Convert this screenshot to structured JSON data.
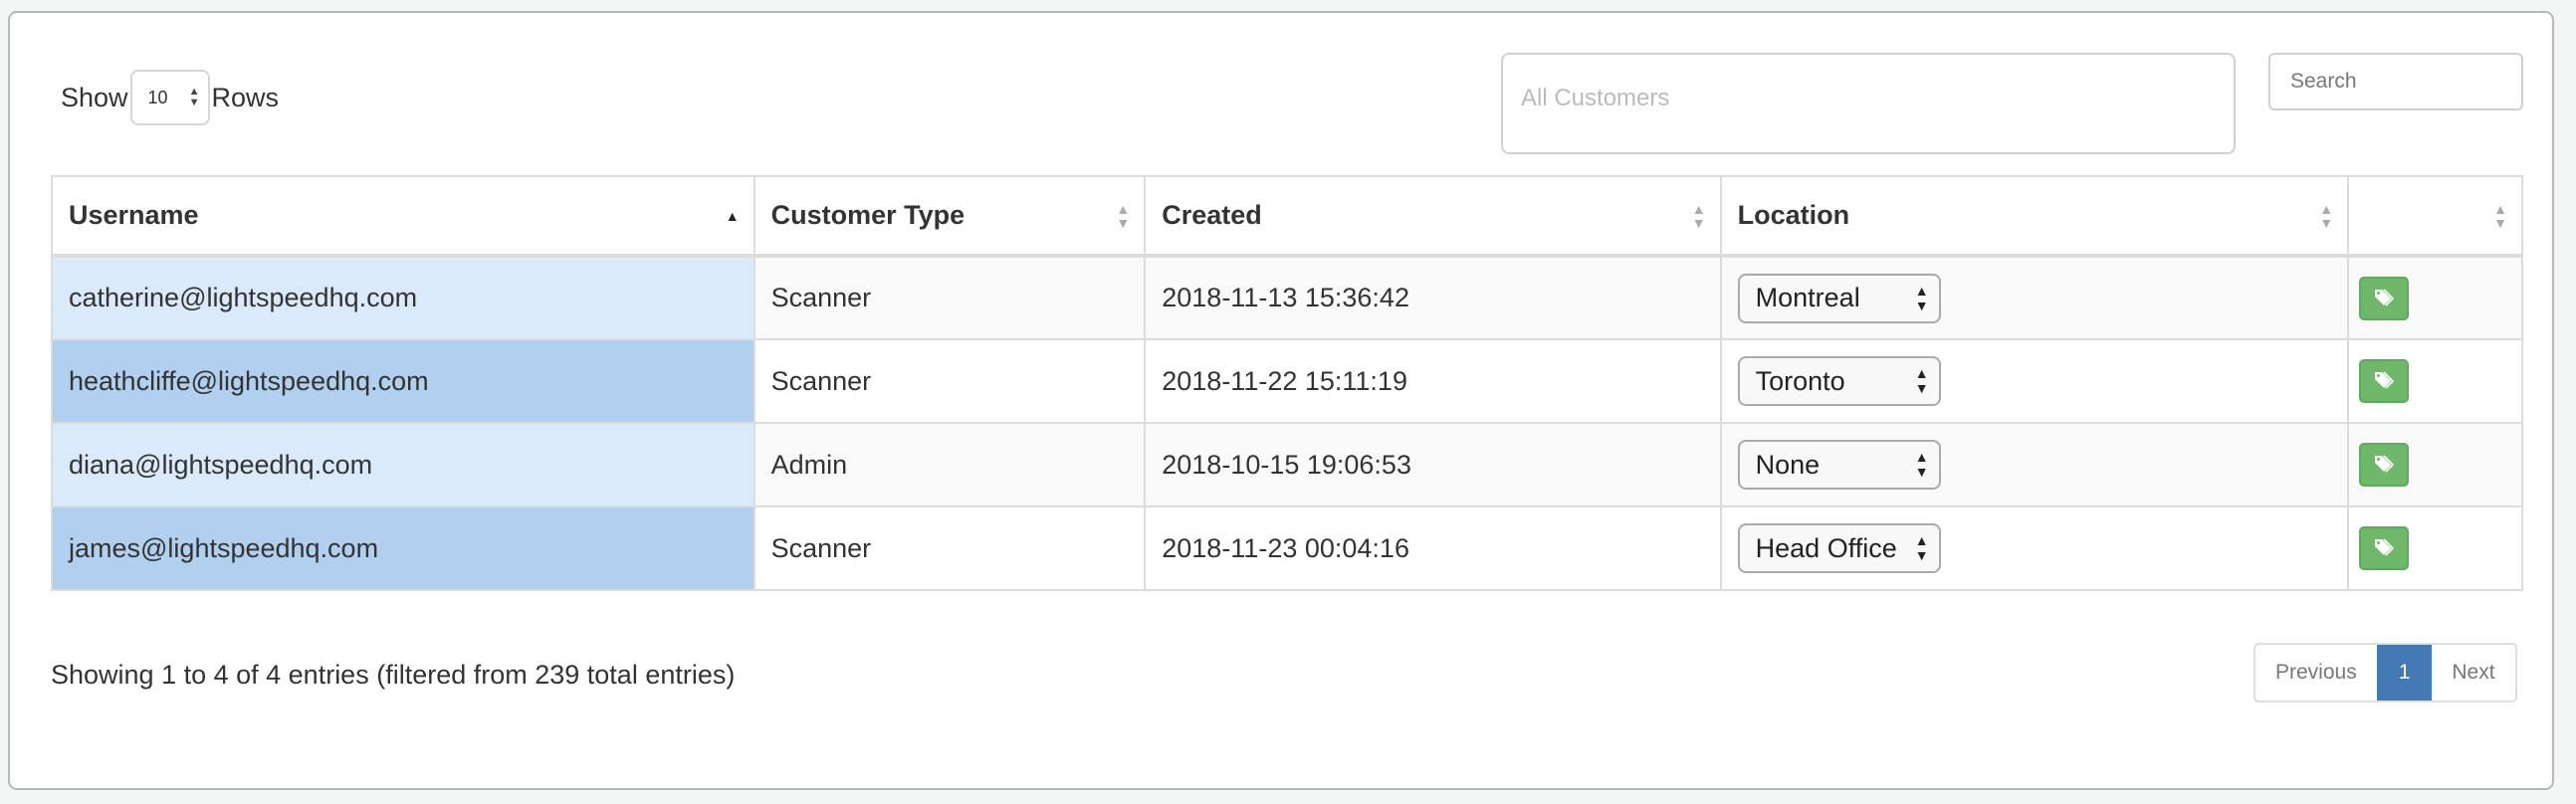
{
  "controls": {
    "show_label": "Show",
    "rows_label": "Rows",
    "page_length": "10",
    "customer_filter_placeholder": "All Customers",
    "search_placeholder": "Search"
  },
  "table": {
    "columns": [
      {
        "label": "Username",
        "sort": "asc"
      },
      {
        "label": "Customer Type",
        "sort": "none"
      },
      {
        "label": "Created",
        "sort": "none"
      },
      {
        "label": "Location",
        "sort": "none"
      },
      {
        "label": "",
        "sort": "none"
      }
    ],
    "rows": [
      {
        "username": "catherine@lightspeedhq.com",
        "type": "Scanner",
        "created": "2018-11-13 15:36:42",
        "location": "Montreal",
        "action_icon": "tags-icon"
      },
      {
        "username": "heathcliffe@lightspeedhq.com",
        "type": "Scanner",
        "created": "2018-11-22 15:11:19",
        "location": "Toronto",
        "action_icon": "tags-icon"
      },
      {
        "username": "diana@lightspeedhq.com",
        "type": "Admin",
        "created": "2018-10-15 19:06:53",
        "location": "None",
        "action_icon": "tags-icon"
      },
      {
        "username": "james@lightspeedhq.com",
        "type": "Scanner",
        "created": "2018-11-23 00:04:16",
        "location": "Head Office",
        "action_icon": "tags-icon"
      }
    ]
  },
  "footer": {
    "info": "Showing 1 to 4 of 4 entries (filtered from 239 total entries)",
    "previous": "Previous",
    "current_page": "1",
    "next": "Next"
  },
  "colors": {
    "tag_button": "#6fb76a",
    "active_page": "#4479b3",
    "selected_light": "#dbeafb",
    "selected_dark": "#b1cfee"
  }
}
